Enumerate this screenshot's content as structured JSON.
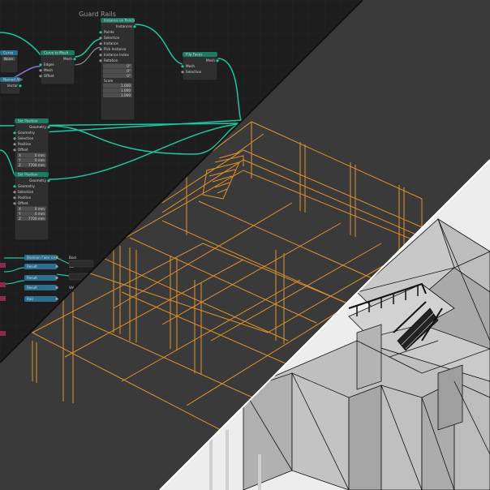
{
  "frame_title": "Guard Rails",
  "colors": {
    "node_editor_bg": "#1d1d1d",
    "grid_line": "#242424",
    "node_body": "#2f2f2f",
    "node_header_geometry": "#1f7a62",
    "node_header_input": "#2b6f8f",
    "node_header_math": "#2c6e8f",
    "node_header_vector": "#8a2b4f",
    "wire_geometry": "#1fc59e",
    "wire_purple": "#8c6fd6",
    "wire_gray": "#a0a0a0",
    "viewport_bg": "#3a3a3a",
    "wireframe": "#e0912c",
    "solid_bg": "#ededed",
    "solid_face": "#b8b8b8",
    "solid_edge": "#111111"
  },
  "nodes": {
    "instance_on_points": {
      "title": "Instance on Points",
      "output": "Instances",
      "inputs": [
        "Points",
        "Selection",
        "Instance",
        "Pick Instance",
        "Instance Index",
        "Rotation"
      ],
      "rotation": [
        "0°",
        "0°",
        "0°"
      ],
      "scale_label": "Scale",
      "scale": [
        "1.000",
        "1.000",
        "1.000"
      ]
    },
    "flip_faces": {
      "title": "Flip Faces",
      "output": "Mesh",
      "inputs": [
        "Mesh",
        "Selection"
      ]
    },
    "curve_node": {
      "title": "Curve",
      "mode": "None"
    },
    "middle_node": {
      "title": "Curve to Mesh",
      "output": "Mesh",
      "inputs": [
        "Edges",
        "Mesh",
        "Offset"
      ]
    },
    "input_node": {
      "title": "Named Attr",
      "output": "Vector"
    },
    "set_position_1": {
      "title": "Set Position",
      "output": "Geometry",
      "inputs": [
        "Geometry",
        "Selection",
        "Position",
        "Offset"
      ],
      "offset": [
        "0 mm",
        "0 mm",
        "7700 mm"
      ],
      "axes": [
        "X",
        "Y",
        "Z"
      ]
    },
    "set_position_2": {
      "title": "Set Position",
      "output": "Geometry",
      "inputs": [
        "Geometry",
        "Selection",
        "Position",
        "Offset"
      ],
      "offset": [
        "0 mm",
        "0 mm",
        "7700 mm"
      ],
      "axes": [
        "X",
        "Y",
        "Z"
      ]
    },
    "lower_nodes": [
      {
        "title": "Boolean Floor on E...",
        "output": "Bool"
      },
      {
        "title": "Result",
        "output": "Val"
      },
      {
        "title": "Result",
        "output": "Val"
      },
      {
        "title": "Result",
        "output": "Val"
      },
      {
        "title": "Rail",
        "output": "Val"
      }
    ]
  }
}
